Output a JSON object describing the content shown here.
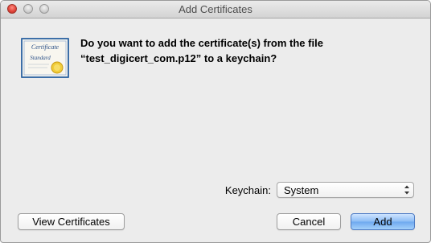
{
  "window": {
    "title": "Add Certificates"
  },
  "message": {
    "line1": "Do you want to add the certificate(s) from the file",
    "line2": "“test_digicert_com.p12” to a keychain?"
  },
  "keychain": {
    "label": "Keychain:",
    "selected": "System"
  },
  "buttons": {
    "view_certificates": "View Certificates",
    "cancel": "Cancel",
    "add": "Add"
  },
  "icon": {
    "name": "certificate-icon",
    "text_top": "Certificate",
    "text_bottom": "Standard"
  },
  "colors": {
    "default_button": "#7ab4f3",
    "close_button": "#e2463c"
  }
}
